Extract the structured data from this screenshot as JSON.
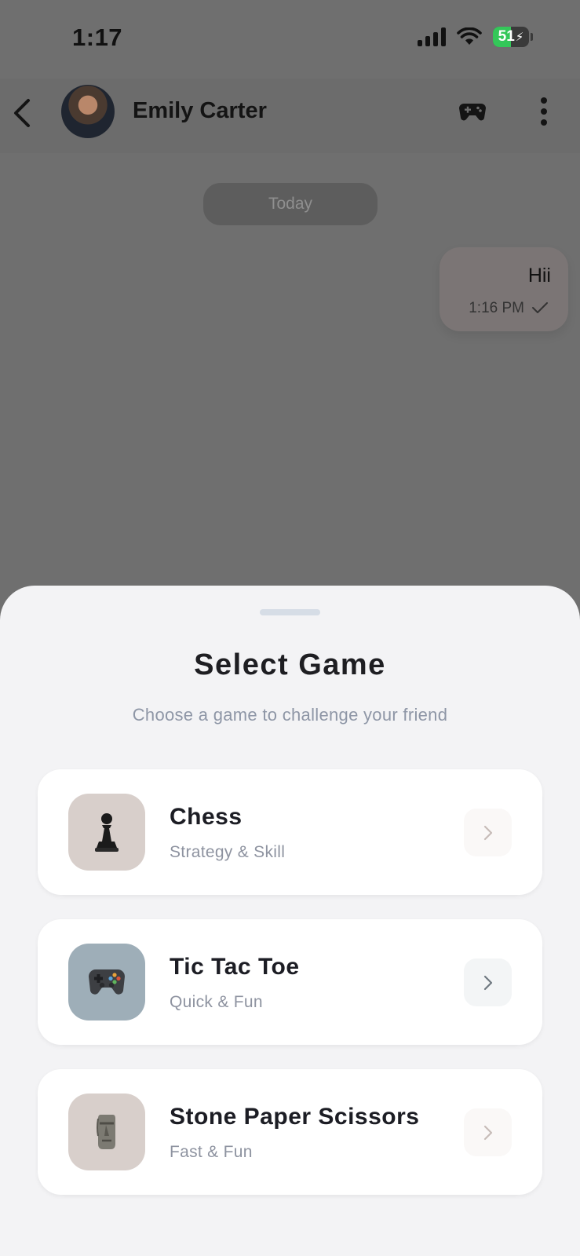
{
  "status_bar": {
    "time": "1:17",
    "battery": "51"
  },
  "header": {
    "contact_name": "Emily Carter"
  },
  "chat": {
    "date_label": "Today",
    "messages": [
      {
        "text": "Hii",
        "time": "1:16 PM"
      }
    ]
  },
  "sheet": {
    "title": "Select Game",
    "subtitle": "Choose a game to challenge your friend",
    "games": [
      {
        "name": "Chess",
        "description": "Strategy & Skill",
        "icon": "chess-pawn-icon",
        "thumb_color": "#d8cfcb"
      },
      {
        "name": "Tic Tac Toe",
        "description": "Quick & Fun",
        "icon": "game-controller-icon",
        "thumb_color": "#9eaeb8"
      },
      {
        "name": "Stone Paper Scissors",
        "description": "Fast & Fun",
        "icon": "moai-stone-icon",
        "thumb_color": "#d8cfcb"
      }
    ]
  },
  "colors": {
    "overlay": "#6f6f6f",
    "sheet_bg": "#f3f3f5",
    "battery_green": "#34c759"
  }
}
